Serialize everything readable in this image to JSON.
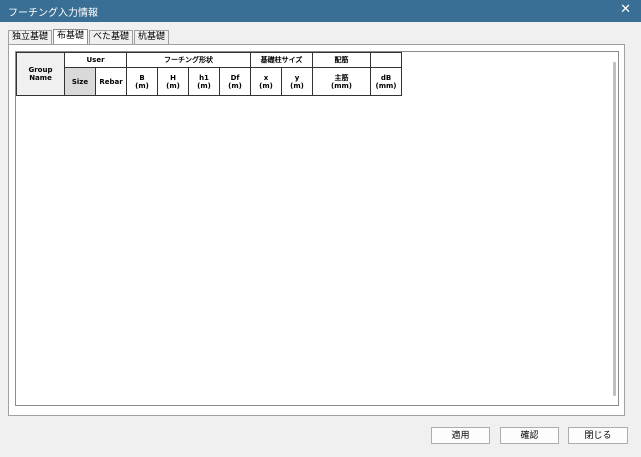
{
  "window": {
    "title": "フーチング入力情報",
    "close_icon": "✕"
  },
  "tabs": [
    {
      "label": "独立基礎"
    },
    {
      "label": "布基礎"
    },
    {
      "label": "べた基礎"
    },
    {
      "label": "杭基礎"
    }
  ],
  "active_tab": 1,
  "grid": {
    "group_name": "Group\nName",
    "user": "User",
    "size": "Size",
    "rebar": "Rebar",
    "footing_shape": "フーチング形状",
    "col_base_size": "基礎柱サイズ",
    "reinforcement": "配筋",
    "B": "B\n(m)",
    "H": "H\n(m)",
    "h1": "h1\n(m)",
    "Df": "Df\n(m)",
    "x": "x\n(m)",
    "y": "y\n(m)",
    "main_bar": "主筋\n(mm)",
    "dB": "dB\n(mm)"
  },
  "buttons": {
    "apply": "適用",
    "confirm": "確認",
    "close": "閉じる"
  }
}
